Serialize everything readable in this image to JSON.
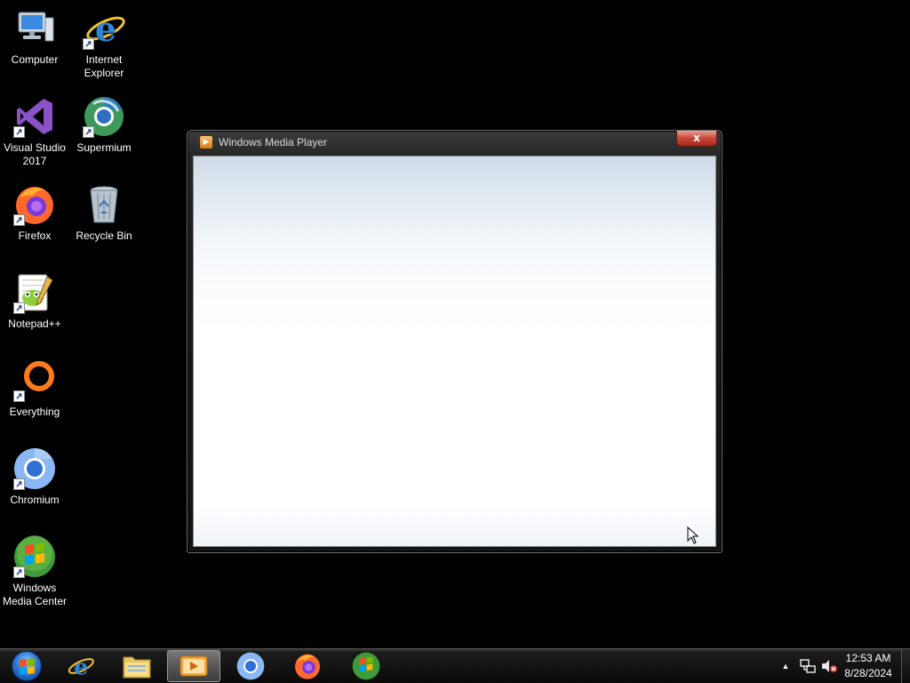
{
  "desktop": {
    "icons": [
      {
        "label": "Computer",
        "icon": "computer-icon"
      },
      {
        "label": "Internet Explorer",
        "icon": "internet-explorer-icon"
      },
      {
        "label": "Visual Studio 2017",
        "icon": "visual-studio-icon"
      },
      {
        "label": "Supermium",
        "icon": "supermium-icon"
      },
      {
        "label": "Firefox",
        "icon": "firefox-icon"
      },
      {
        "label": "Recycle Bin",
        "icon": "recycle-bin-icon"
      },
      {
        "label": "Notepad++",
        "icon": "notepad-plus-plus-icon"
      },
      {
        "label": "Everything",
        "icon": "everything-icon"
      },
      {
        "label": "Chromium",
        "icon": "chromium-icon"
      },
      {
        "label": "Windows Media Center",
        "icon": "windows-media-center-icon"
      }
    ]
  },
  "window": {
    "title": "Windows Media Player",
    "close_label": "x",
    "accent": "#c8483a"
  },
  "taskbar": {
    "items": [
      {
        "name": "start",
        "icon": "windows-start-orb-icon"
      },
      {
        "name": "internet-explorer",
        "icon": "internet-explorer-icon"
      },
      {
        "name": "windows-explorer",
        "icon": "folder-icon"
      },
      {
        "name": "windows-media-player",
        "icon": "media-player-icon",
        "active": true
      },
      {
        "name": "chromium",
        "icon": "chromium-icon"
      },
      {
        "name": "firefox",
        "icon": "firefox-icon"
      },
      {
        "name": "windows-media-center",
        "icon": "windows-media-center-icon"
      }
    ],
    "tray": {
      "show_hidden_glyph": "▲",
      "network_icon": "network-icon",
      "volume_icon": "volume-muted-icon",
      "time": "12:53 AM",
      "date": "8/28/2024"
    }
  }
}
